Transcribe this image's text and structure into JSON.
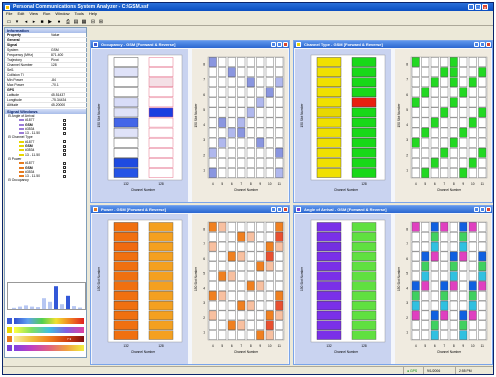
{
  "app_title": "Personal Communications System Analyzer - C:\\GSM.ssf",
  "menu": [
    "File",
    "Edit",
    "View",
    "Run",
    "Window",
    "Tools",
    "Help"
  ],
  "left_panel": {
    "info_header": "Information",
    "prop_col": "Property",
    "val_col": "Value",
    "groups": [
      "General",
      "Signal"
    ],
    "props": [
      {
        "k": "System",
        "v": "GSM"
      },
      {
        "k": "Frequency (MHz)",
        "v": "871.400"
      },
      {
        "k": "Trajectory",
        "v": "Pivot"
      },
      {
        "k": "Channel Number",
        "v": "128"
      },
      {
        "k": "Sel1",
        "v": ""
      },
      {
        "k": "Collision Tl",
        "v": ""
      },
      {
        "k": "Min Power",
        "v": "-84"
      },
      {
        "k": "Max Power",
        "v": "-70.1"
      }
    ],
    "gps_group": "GPS",
    "gps": [
      {
        "k": "Latitude",
        "v": "45.51437"
      },
      {
        "k": "Longitude",
        "v": "-75.34434"
      },
      {
        "k": "Altitude",
        "v": "45.20000"
      }
    ],
    "windows_header": "Signal Windows",
    "tree": [
      {
        "label": "Angle of Arrival",
        "level": 0
      },
      {
        "label": "#1877",
        "level": 1,
        "check": ""
      },
      {
        "label": "GSM",
        "level": 1,
        "check": "✓",
        "bold": true
      },
      {
        "label": "#3534",
        "level": 1,
        "check": ""
      },
      {
        "label": "13 - 11.50",
        "level": 1,
        "check": ""
      },
      {
        "label": "Channel Type",
        "level": 0
      },
      {
        "label": "#1877",
        "level": 1,
        "check": ""
      },
      {
        "label": "GSM",
        "level": 1,
        "check": "✓",
        "bold": true
      },
      {
        "label": "#3534",
        "level": 1,
        "check": ""
      },
      {
        "label": "13 - 11.50",
        "level": 1,
        "check": ""
      },
      {
        "label": "Power",
        "level": 0
      },
      {
        "label": "#1877",
        "level": 1,
        "check": ""
      },
      {
        "label": "GSM",
        "level": 1,
        "check": "✓",
        "bold": true
      },
      {
        "label": "#3534",
        "level": 1,
        "check": ""
      },
      {
        "label": "13 - 11.50",
        "level": 1,
        "check": ""
      },
      {
        "label": "Occupancy",
        "level": 0
      }
    ],
    "mini_bars": [
      0.05,
      0.1,
      0.15,
      0.1,
      0.08,
      0.45,
      0.3,
      0.95,
      0.2,
      0.55,
      0.12,
      0.06
    ],
    "mini_colors": [
      "#b6c6f2",
      "#b6c6f2",
      "#b6c6f2",
      "#b6c6f2",
      "#b6c6f2",
      "#b6c6f2",
      "#b6c6f2",
      "#3358d8",
      "#b6c6f2",
      "#3358d8",
      "#b6c6f2",
      "#b6c6f2"
    ],
    "legend_labels": [
      "",
      "",
      "7.3",
      ""
    ]
  },
  "windows": [
    {
      "title": "Occupancy - GSM [Forward & Reverse]",
      "icon": "#3b5bd6",
      "left_label": "150 Slot Number",
      "xlabel": "Channel Number",
      "left_cols": [
        "132",
        "128"
      ],
      "right_cols": [
        "4",
        "5",
        "6",
        "7",
        "8",
        "9",
        "10",
        "11"
      ],
      "right_y": [
        "8",
        "7",
        "6",
        "5",
        "4",
        "3",
        "2",
        "1"
      ]
    },
    {
      "title": "Channel Type - GSM [Forward & Reverse]",
      "icon": "#e8d600",
      "left_label": "150 Slot Number",
      "xlabel": "Channel Number",
      "left_cols": [
        "",
        "128"
      ],
      "right_cols": [
        "4",
        "5",
        "6",
        "7",
        "8",
        "9",
        "10",
        "11"
      ],
      "right_y": [
        "8",
        "7",
        "6",
        "5",
        "4",
        "3",
        "2",
        "1"
      ]
    },
    {
      "title": "Power - GSM [Forward & Reverse]",
      "icon": "#e67a1e",
      "left_label": "150 Slot Number",
      "xlabel": "Channel Number",
      "left_cols": [
        "132",
        "128"
      ],
      "right_cols": [
        "4",
        "5",
        "6",
        "7",
        "8",
        "9",
        "10",
        "11"
      ],
      "right_y": [
        "8",
        "7",
        "6",
        "5",
        "4",
        "3",
        "2",
        "1"
      ]
    },
    {
      "title": "Angle of Arrival - GSM [Forward & Reverse]",
      "icon": "#7a3fd6",
      "left_label": "150 Slot Number",
      "xlabel": "Channel Number",
      "left_cols": [
        "132",
        "128"
      ],
      "right_cols": [
        "4",
        "5",
        "6",
        "7",
        "8",
        "9",
        "10",
        "11"
      ],
      "right_y": [
        "8",
        "7",
        "6",
        "5",
        "4",
        "3",
        "2",
        "1"
      ]
    }
  ],
  "status": {
    "gps": "GPS",
    "date": "9/1/2006",
    "time": "2:55 PM"
  }
}
